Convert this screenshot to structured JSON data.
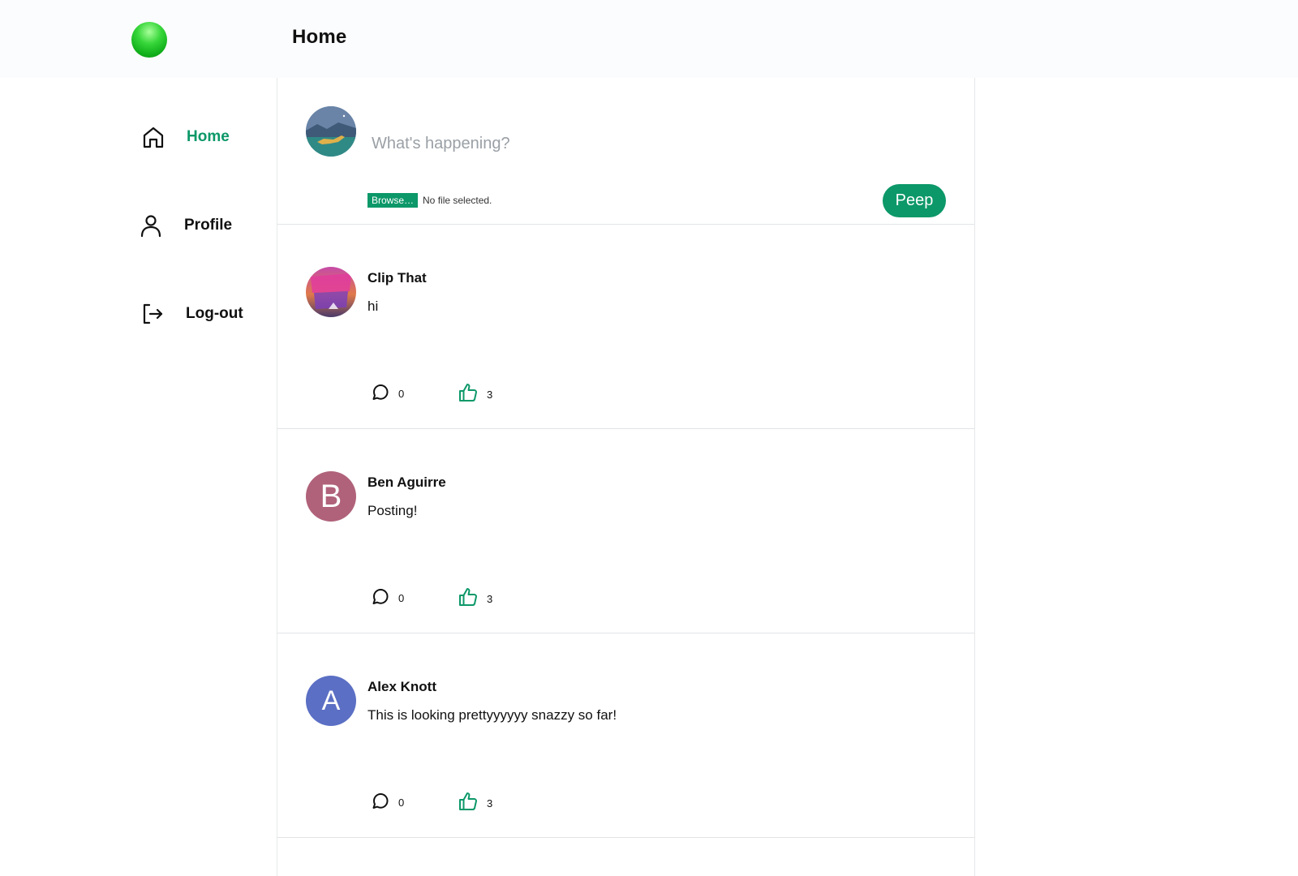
{
  "header": {
    "title": "Home"
  },
  "sidebar": {
    "items": [
      {
        "label": "Home",
        "icon": "home-icon",
        "active": true
      },
      {
        "label": "Profile",
        "icon": "user-icon",
        "active": false
      },
      {
        "label": "Log-out",
        "icon": "logout-icon",
        "active": false
      }
    ]
  },
  "composer": {
    "placeholder": "What's happening?",
    "browse_label": "Browse…",
    "file_status": "No file selected.",
    "submit_label": "Peep"
  },
  "posts": [
    {
      "author": "Clip That",
      "content": "hi",
      "comments": "0",
      "likes": "3",
      "avatar_text": ""
    },
    {
      "author": "Ben Aguirre",
      "content": "Posting!",
      "comments": "0",
      "likes": "3",
      "avatar_text": "B"
    },
    {
      "author": "Alex Knott",
      "content": "This is looking prettyyyyyy snazzy so far!",
      "comments": "0",
      "likes": "3",
      "avatar_text": "A"
    }
  ],
  "colors": {
    "accent": "#0c9868",
    "avatar_b": "#b0627a",
    "avatar_a": "#5b6fc4"
  }
}
